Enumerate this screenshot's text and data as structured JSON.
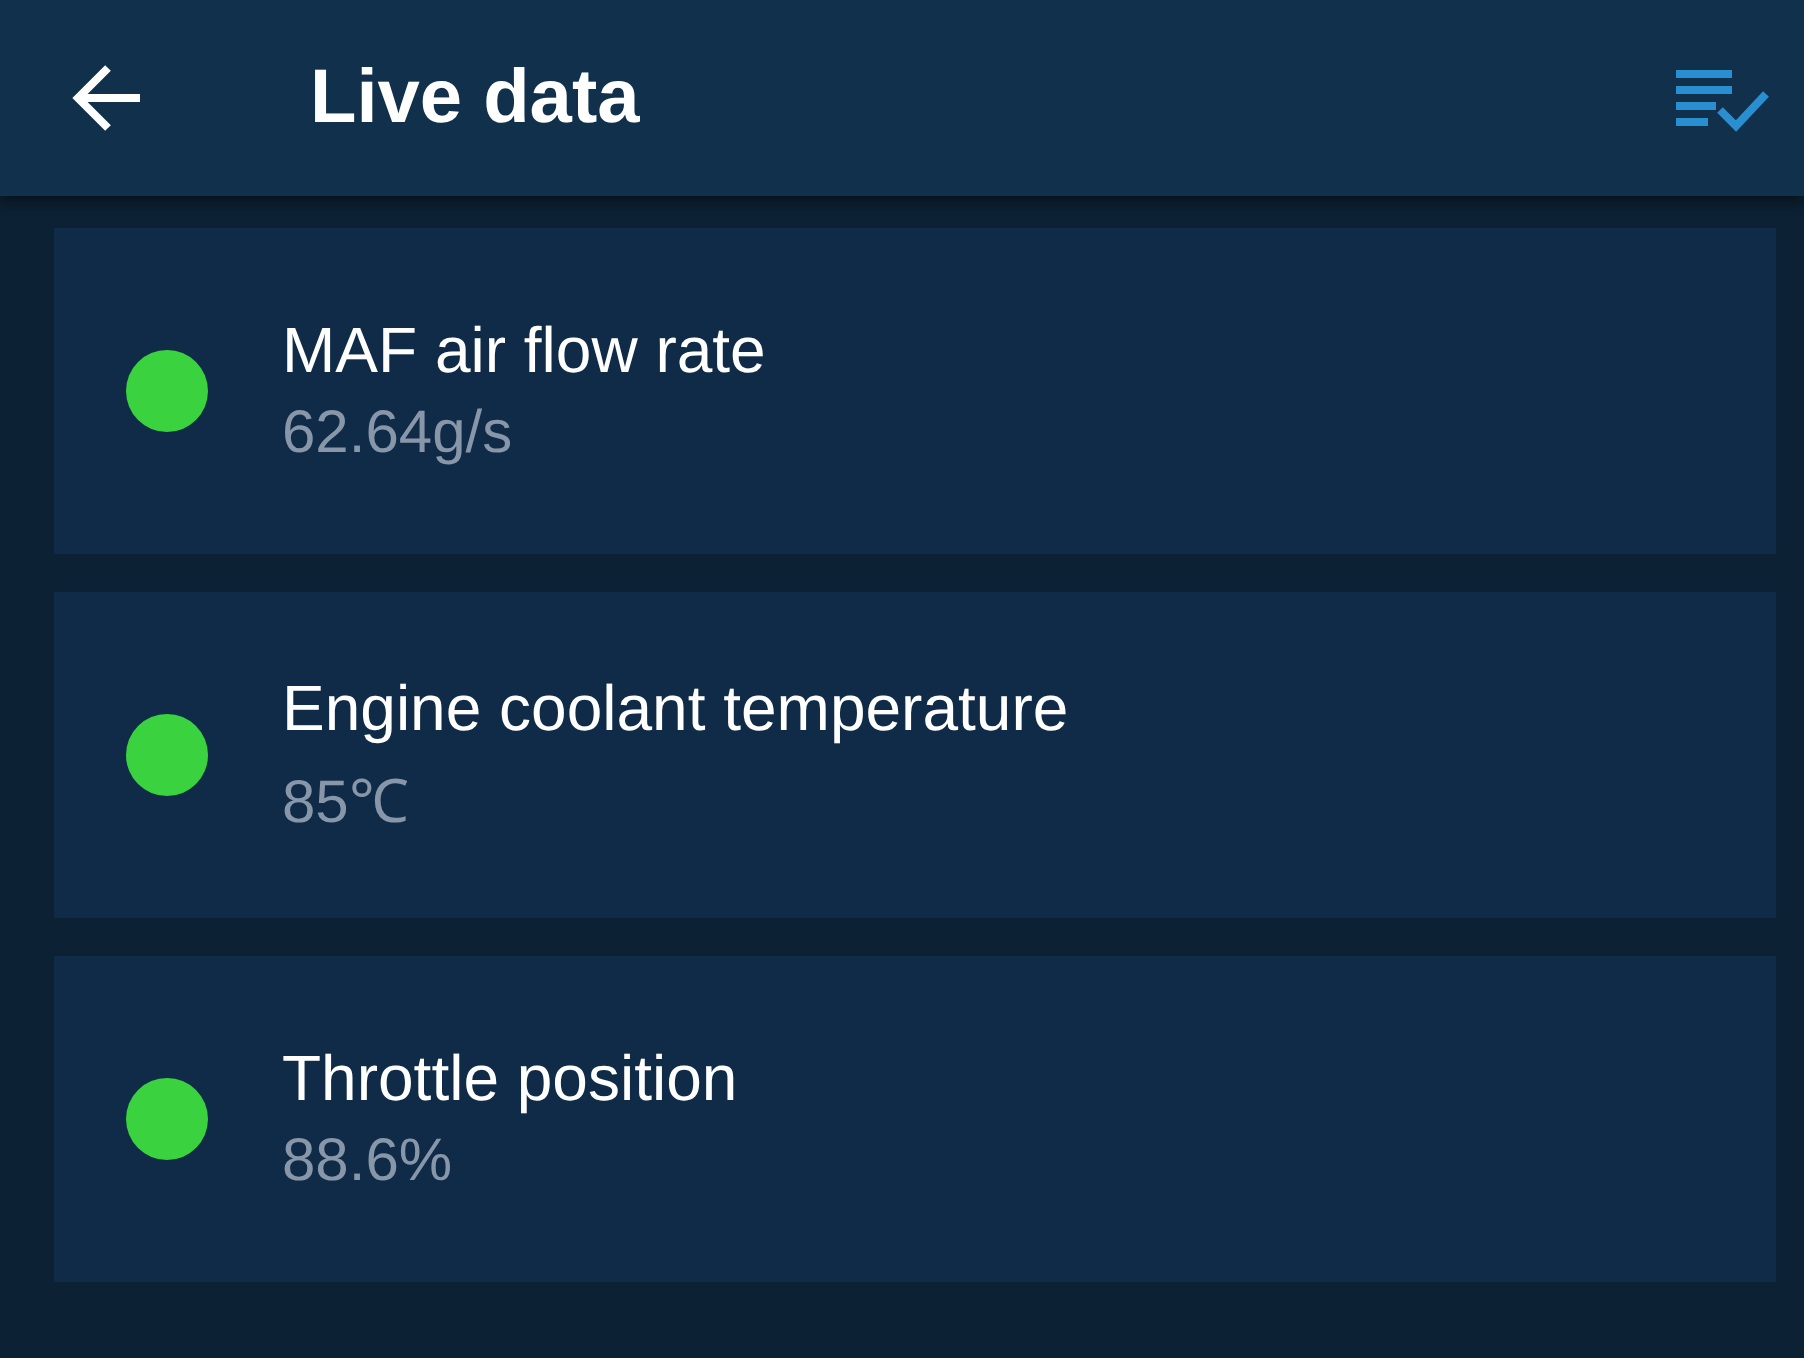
{
  "header": {
    "title": "Live data"
  },
  "parameters": [
    {
      "name": "MAF air flow rate",
      "value": "62.64g/s",
      "color": "#3ad33f"
    },
    {
      "name": "Engine coolant temperature",
      "value": "85℃",
      "color": "#3ad33f"
    },
    {
      "name": "Throttle position",
      "value": "88.6%",
      "color": "#3ad33f"
    }
  ]
}
